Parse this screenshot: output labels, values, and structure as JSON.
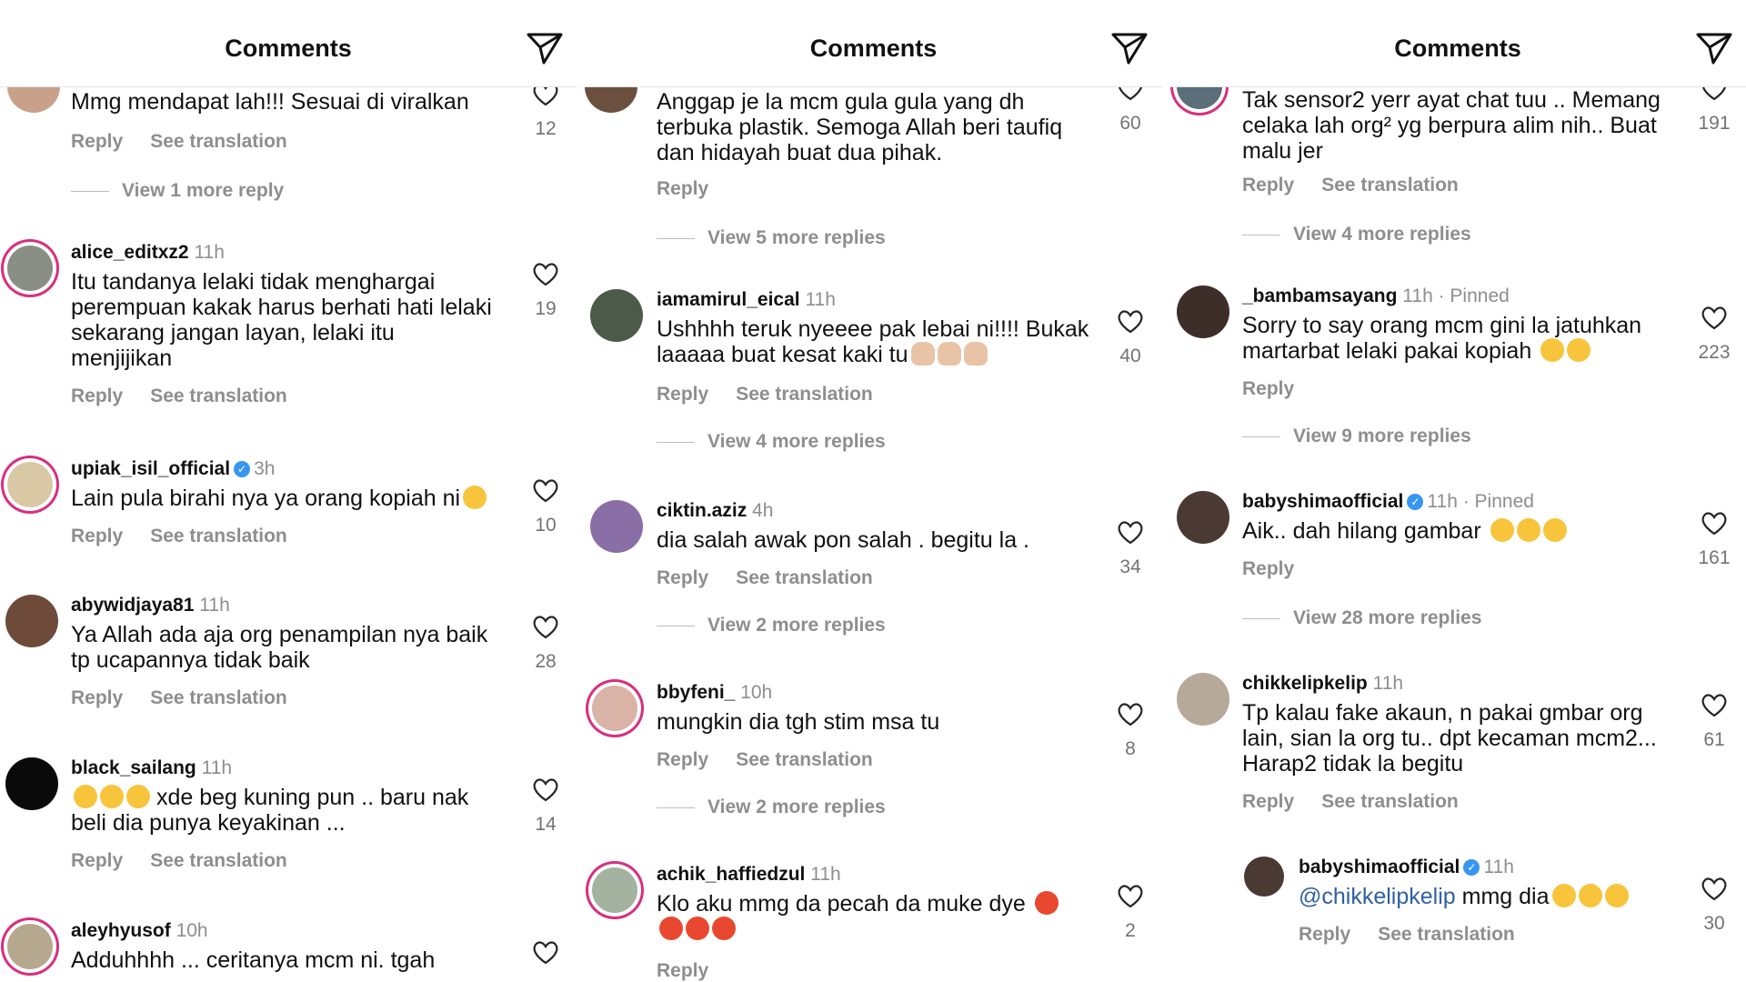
{
  "panels": [
    {
      "title": "Comments",
      "comments": [
        {
          "text": "Mmg mendapat lah!!! Sesuai di viralkan",
          "actions": [
            "Reply",
            "See translation"
          ],
          "likes": "12",
          "more_replies": "View 1 more reply"
        },
        {
          "user": "alice_editxz2",
          "time": "11h",
          "text": "Itu tandanya lelaki tidak menghargai perempuan kakak harus berhati hati lelaki sekarang jangan layan, lelaki itu menjijikan",
          "actions": [
            "Reply",
            "See translation"
          ],
          "likes": "19"
        },
        {
          "user": "upiak_isil_official",
          "time": "3h",
          "verified": true,
          "text": "Lain pula birahi nya ya orang kopiah ni",
          "actions": [
            "Reply",
            "See translation"
          ],
          "likes": "10"
        },
        {
          "user": "abywidjaya81",
          "time": "11h",
          "text": "Ya Allah ada aja org penampilan nya baik tp ucapannya tidak baik",
          "actions": [
            "Reply",
            "See translation"
          ],
          "likes": "28"
        },
        {
          "user": "black_sailang",
          "time": "11h",
          "text": "xde beg kuning pun .. baru nak beli dia punya keyakinan ...",
          "actions": [
            "Reply",
            "See translation"
          ],
          "likes": "14"
        },
        {
          "user": "aleyhyusof",
          "time": "10h",
          "text": "Adduhhhh ... ceritanya mcm ni. tgah"
        }
      ]
    },
    {
      "title": "Comments",
      "comments": [
        {
          "text": "Anggap je la mcm gula gula yang dh terbuka plastik. Semoga Allah beri taufiq dan hidayah buat dua pihak.",
          "actions": [
            "Reply"
          ],
          "likes": "60",
          "more_replies": "View 5 more replies"
        },
        {
          "user": "iamamirul_eical",
          "time": "11h",
          "text": "Ushhhh teruk nyeeee pak lebai ni!!!! Bukak laaaaa buat kesat kaki tu",
          "actions": [
            "Reply",
            "See translation"
          ],
          "likes": "40",
          "more_replies": "View 4 more replies"
        },
        {
          "user": "ciktin.aziz",
          "time": "4h",
          "text": "dia salah awak pon salah . begitu la .",
          "actions": [
            "Reply",
            "See translation"
          ],
          "likes": "34",
          "more_replies": "View 2 more replies"
        },
        {
          "user": "bbyfeni_",
          "time": "10h",
          "text": "mungkin dia tgh stim msa tu",
          "actions": [
            "Reply",
            "See translation"
          ],
          "likes": "8",
          "more_replies": "View 2 more replies"
        },
        {
          "user": "achik_haffiedzul",
          "time": "11h",
          "text": "Klo aku mmg da pecah da muke dye",
          "actions": [
            "Reply"
          ],
          "likes": "2"
        }
      ]
    },
    {
      "title": "Comments",
      "comments": [
        {
          "text": "Tak sensor2 yerr ayat chat tuu .. Memang celaka lah org² yg berpura alim nih.. Buat malu jer",
          "actions": [
            "Reply",
            "See translation"
          ],
          "likes": "191",
          "more_replies": "View 4 more replies"
        },
        {
          "user": "_bambamsayang",
          "time": "11h",
          "pinned": "· Pinned",
          "text": "Sorry to say orang mcm gini la jatuhkan martarbat lelaki pakai kopiah",
          "actions": [
            "Reply"
          ],
          "likes": "223",
          "more_replies": "View 9 more replies"
        },
        {
          "user": "babyshimaofficial",
          "time": "11h",
          "pinned": "· Pinned",
          "verified": true,
          "text": "Aik.. dah hilang gambar",
          "actions": [
            "Reply"
          ],
          "likes": "161",
          "more_replies": "View 28 more replies"
        },
        {
          "user": "chikkelipkelip",
          "time": "11h",
          "text": "Tp kalau fake akaun, n pakai gmbar org lain, sian la org tu.. dpt kecaman mcm2... Harap2 tidak la begitu",
          "actions": [
            "Reply",
            "See translation"
          ],
          "likes": "61"
        },
        {
          "user": "babyshimaofficial",
          "time": "11h",
          "verified": true,
          "mention": "@chikkelipkelip",
          "text": "mmg dia",
          "actions": [
            "Reply",
            "See translation"
          ],
          "likes": "30"
        }
      ]
    }
  ],
  "colors": {
    "accent_ring": "#d92e7f",
    "verified": "#3797f0",
    "mention": "#2f5fa4",
    "muted": "#8e8e8e"
  },
  "icons": {
    "share": "send-icon",
    "like": "heart-icon",
    "verified": "verified-badge-icon"
  }
}
